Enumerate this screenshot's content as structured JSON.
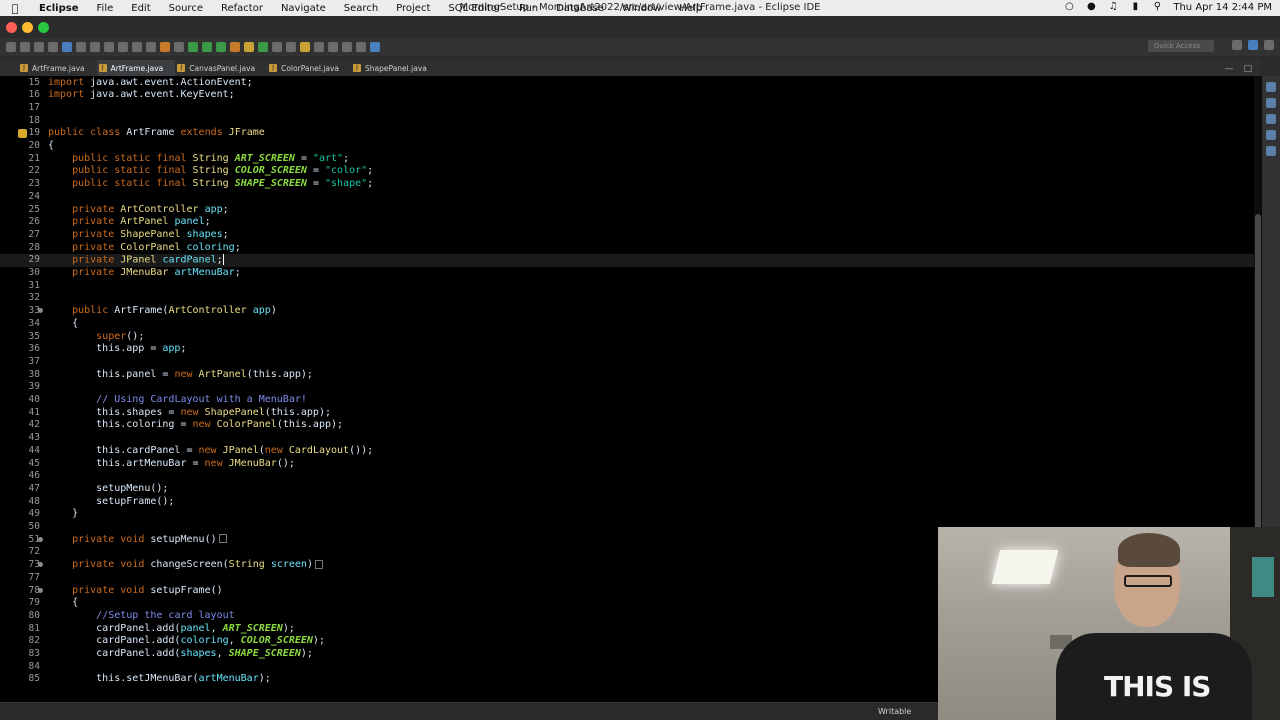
{
  "menubar": {
    "app": "Eclipse",
    "items": [
      "File",
      "Edit",
      "Source",
      "Refactor",
      "Navigate",
      "Search",
      "Project",
      "SQL Editor",
      "Run",
      "Database",
      "Window",
      "Help"
    ],
    "window_title": "MorningSetup - MorningArt2022/src/art/view/ArtFrame.java - Eclipse IDE",
    "clock": "Thu Apr 14  2:44 PM"
  },
  "toolbar": {
    "quick_access_placeholder": "Quick Access"
  },
  "tabs": [
    "ArtFrame.java",
    "ArtFrame.java",
    "CanvasPanel.java",
    "ColorPanel.java",
    "ShapePanel.java"
  ],
  "active_tab_index": 1,
  "status": {
    "mode": "Writable"
  },
  "code_lines": [
    {
      "n": "15",
      "t": "import java.awt.event.ActionEvent;"
    },
    {
      "n": "16",
      "t": "import java.awt.event.KeyEvent;"
    },
    {
      "n": "17",
      "t": ""
    },
    {
      "n": "18",
      "t": ""
    },
    {
      "n": "19",
      "t": "public class ArtFrame extends JFrame"
    },
    {
      "n": "20",
      "t": "{"
    },
    {
      "n": "21",
      "t": "    public static final String ART_SCREEN = \"art\";"
    },
    {
      "n": "22",
      "t": "    public static final String COLOR_SCREEN = \"color\";"
    },
    {
      "n": "23",
      "t": "    public static final String SHAPE_SCREEN = \"shape\";"
    },
    {
      "n": "24",
      "t": ""
    },
    {
      "n": "25",
      "t": "    private ArtController app;"
    },
    {
      "n": "26",
      "t": "    private ArtPanel panel;"
    },
    {
      "n": "27",
      "t": "    private ShapePanel shapes;"
    },
    {
      "n": "28",
      "t": "    private ColorPanel coloring;"
    },
    {
      "n": "29",
      "t": "    private JPanel cardPanel;"
    },
    {
      "n": "30",
      "t": "    private JMenuBar artMenuBar;"
    },
    {
      "n": "31",
      "t": ""
    },
    {
      "n": "32",
      "t": ""
    },
    {
      "n": "33",
      "t": "    public ArtFrame(ArtController app)"
    },
    {
      "n": "34",
      "t": "    {"
    },
    {
      "n": "35",
      "t": "        super();"
    },
    {
      "n": "36",
      "t": "        this.app = app;"
    },
    {
      "n": "37",
      "t": ""
    },
    {
      "n": "38",
      "t": "        this.panel = new ArtPanel(this.app);"
    },
    {
      "n": "39",
      "t": ""
    },
    {
      "n": "40",
      "t": "        // Using CardLayout with a MenuBar!"
    },
    {
      "n": "41",
      "t": "        this.shapes = new ShapePanel(this.app);"
    },
    {
      "n": "42",
      "t": "        this.coloring = new ColorPanel(this.app);"
    },
    {
      "n": "43",
      "t": ""
    },
    {
      "n": "44",
      "t": "        this.cardPanel = new JPanel(new CardLayout());"
    },
    {
      "n": "45",
      "t": "        this.artMenuBar = new JMenuBar();"
    },
    {
      "n": "46",
      "t": ""
    },
    {
      "n": "47",
      "t": "        setupMenu();"
    },
    {
      "n": "48",
      "t": "        setupFrame();"
    },
    {
      "n": "49",
      "t": "    }"
    },
    {
      "n": "50",
      "t": ""
    },
    {
      "n": "51",
      "t": "    private void setupMenu()"
    },
    {
      "n": "72",
      "t": ""
    },
    {
      "n": "73",
      "t": "    private void changeScreen(String screen)"
    },
    {
      "n": "77",
      "t": ""
    },
    {
      "n": "78",
      "t": "    private void setupFrame()"
    },
    {
      "n": "79",
      "t": "    {"
    },
    {
      "n": "80",
      "t": "        //Setup the card layout"
    },
    {
      "n": "81",
      "t": "        cardPanel.add(panel, ART_SCREEN);"
    },
    {
      "n": "82",
      "t": "        cardPanel.add(coloring, COLOR_SCREEN);"
    },
    {
      "n": "83",
      "t": "        cardPanel.add(shapes, SHAPE_SCREEN);"
    },
    {
      "n": "84",
      "t": ""
    },
    {
      "n": "85",
      "t": "        this.setJMenuBar(artMenuBar);"
    }
  ],
  "webcam": {
    "shirt_text": "THIS IS"
  }
}
